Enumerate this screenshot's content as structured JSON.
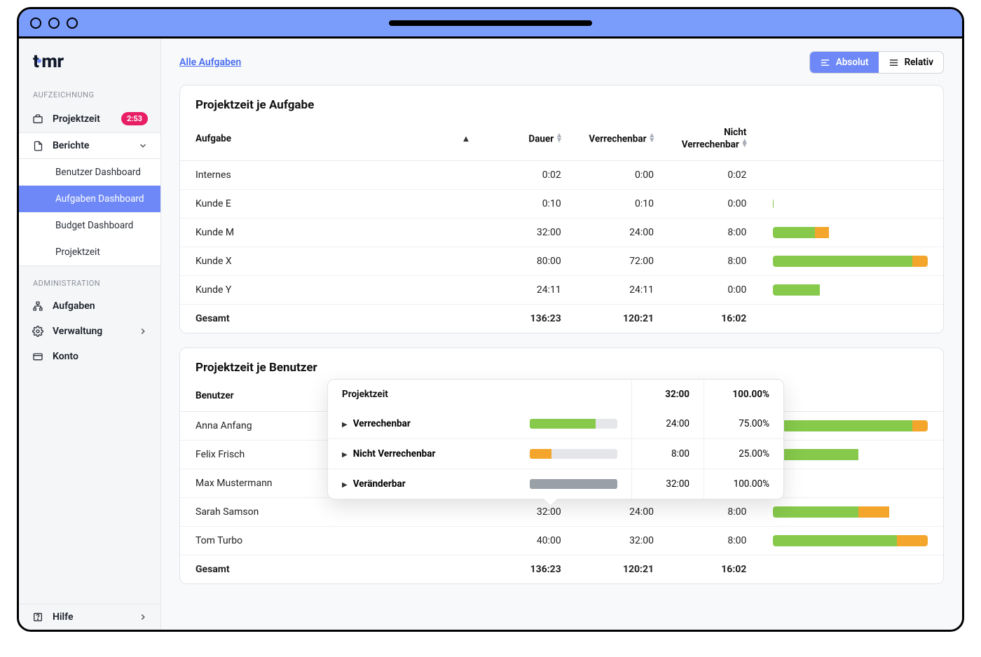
{
  "logo": "timr",
  "sidebar": {
    "section_recording": "AUFZEICHNUNG",
    "projektzeit": "Projektzeit",
    "projektzeit_badge": "2:53",
    "berichte": "Berichte",
    "sub": {
      "benutzer": "Benutzer Dashboard",
      "aufgaben": "Aufgaben Dashboard",
      "budget": "Budget Dashboard",
      "projektzeit": "Projektzeit"
    },
    "section_admin": "ADMINISTRATION",
    "aufgaben": "Aufgaben",
    "verwaltung": "Verwaltung",
    "konto": "Konto",
    "hilfe": "Hilfe"
  },
  "topbar": {
    "breadcrumb": "Alle Aufgaben",
    "absolut": "Absolut",
    "relativ": "Relativ"
  },
  "table1": {
    "title": "Projektzeit je Aufgabe",
    "h_aufgabe": "Aufgabe",
    "h_dauer": "Dauer",
    "h_verr": "Verrechenbar",
    "h_nichtverr_l1": "Nicht",
    "h_nichtverr_l2": "Verrechenbar",
    "rows": [
      {
        "name": "Internes",
        "dauer": "0:02",
        "verr": "0:00",
        "nverr": "0:02",
        "g": 0,
        "o": 0
      },
      {
        "name": "Kunde E",
        "dauer": "0:10",
        "verr": "0:10",
        "nverr": "0:00",
        "g": 0.5,
        "o": 0
      },
      {
        "name": "Kunde M",
        "dauer": "32:00",
        "verr": "24:00",
        "nverr": "8:00",
        "g": 27,
        "o": 9
      },
      {
        "name": "Kunde X",
        "dauer": "80:00",
        "verr": "72:00",
        "nverr": "8:00",
        "g": 90,
        "o": 10
      },
      {
        "name": "Kunde Y",
        "dauer": "24:11",
        "verr": "24:11",
        "nverr": "0:00",
        "g": 30,
        "o": 0
      }
    ],
    "total": {
      "name": "Gesamt",
      "dauer": "136:23",
      "verr": "120:21",
      "nverr": "16:02"
    }
  },
  "table2": {
    "title": "Projektzeit je Benutzer",
    "h_benutzer": "Benutzer",
    "rows": [
      {
        "name": "Anna Anfang",
        "dauer": "",
        "verr": "",
        "nverr": "",
        "g": 90,
        "o": 10
      },
      {
        "name": "Felix Frisch",
        "dauer": "",
        "verr": "",
        "nverr": "",
        "g": 55,
        "o": 0
      },
      {
        "name": "Max Mustermann",
        "dauer": "",
        "verr": "",
        "nverr": ""
      },
      {
        "name": "Sarah Samson",
        "dauer": "32:00",
        "verr": "24:00",
        "nverr": "8:00",
        "g": 55,
        "o": 20
      },
      {
        "name": "Tom Turbo",
        "dauer": "40:00",
        "verr": "32:00",
        "nverr": "8:00",
        "g": 80,
        "o": 20
      }
    ],
    "total": {
      "name": "Gesamt",
      "dauer": "136:23",
      "verr": "120:21",
      "nverr": "16:02"
    }
  },
  "popover": {
    "title": "Projektzeit",
    "title_val": "32:00",
    "title_pct": "100.00%",
    "rows": [
      {
        "label": "Verrechenbar",
        "fill": 75,
        "color": "green",
        "val": "24:00",
        "pct": "75.00%"
      },
      {
        "label": "Nicht Verrechenbar",
        "fill": 25,
        "color": "orange",
        "val": "8:00",
        "pct": "25.00%"
      },
      {
        "label": "Veränderbar",
        "fill": 100,
        "color": "grey",
        "val": "32:00",
        "pct": "100.00%"
      }
    ]
  }
}
